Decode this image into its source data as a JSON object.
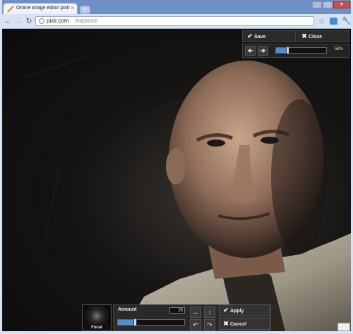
{
  "browser": {
    "tab_title": "Online image editor pixlr free",
    "tab_close": "×",
    "new_tab": "+",
    "window_controls": [
      "_",
      "□",
      "✕"
    ],
    "url_host": "pixlr.com",
    "url_path": "/express/"
  },
  "icons": {
    "back": "arrow-left-icon",
    "forward": "arrow-right-icon",
    "reload": "reload-icon",
    "star": "star-icon",
    "wrench": "wrench-icon"
  },
  "top_panel": {
    "save_label": "Save",
    "close_label": "Close",
    "zoom_percent": "58%",
    "zoom_level": 0.22
  },
  "bottom_panel": {
    "preset_label": "Focal",
    "amount_label": "Amount",
    "amount_value": "25",
    "amount_level": 0.25,
    "apply_label": "Apply",
    "cancel_label": "Cancel"
  },
  "colors": {
    "accent": "#4a8ed8",
    "panel": "#2a2a2a"
  }
}
